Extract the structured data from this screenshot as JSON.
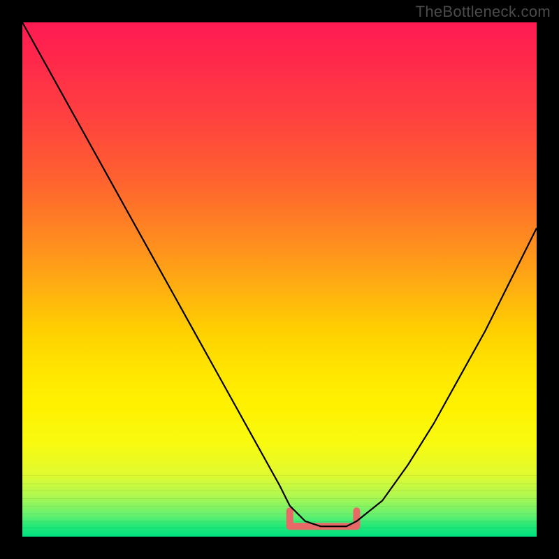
{
  "watermark": "TheBottleneck.com",
  "colors": {
    "frame_bg": "#000000",
    "curve": "#000000",
    "valley_marker": "#e86a68",
    "gradient_top": "#ff1a52",
    "gradient_bottom": "#00e080"
  },
  "chart_data": {
    "type": "line",
    "title": "",
    "xlabel": "",
    "ylabel": "",
    "xlim": [
      0,
      100
    ],
    "ylim": [
      0,
      100
    ],
    "series": [
      {
        "name": "bottleneck-curve",
        "x": [
          0,
          5,
          10,
          15,
          20,
          25,
          30,
          35,
          40,
          45,
          50,
          52,
          55,
          58,
          60,
          63,
          65,
          70,
          75,
          80,
          85,
          90,
          95,
          100
        ],
        "y": [
          100,
          91,
          82,
          73,
          64,
          55,
          46,
          37,
          28,
          19,
          10,
          6,
          3,
          2,
          2,
          2,
          3,
          7,
          14,
          22,
          31,
          40,
          50,
          60
        ]
      }
    ],
    "valley": {
      "x_start": 52,
      "x_end": 65,
      "y": 2
    },
    "background_gradient": {
      "stops": [
        {
          "offset": 0.0,
          "color": "#ff1a52"
        },
        {
          "offset": 0.3,
          "color": "#ff6030"
        },
        {
          "offset": 0.6,
          "color": "#ffd000"
        },
        {
          "offset": 0.82,
          "color": "#e0fa30"
        },
        {
          "offset": 1.0,
          "color": "#00e080"
        }
      ]
    }
  }
}
